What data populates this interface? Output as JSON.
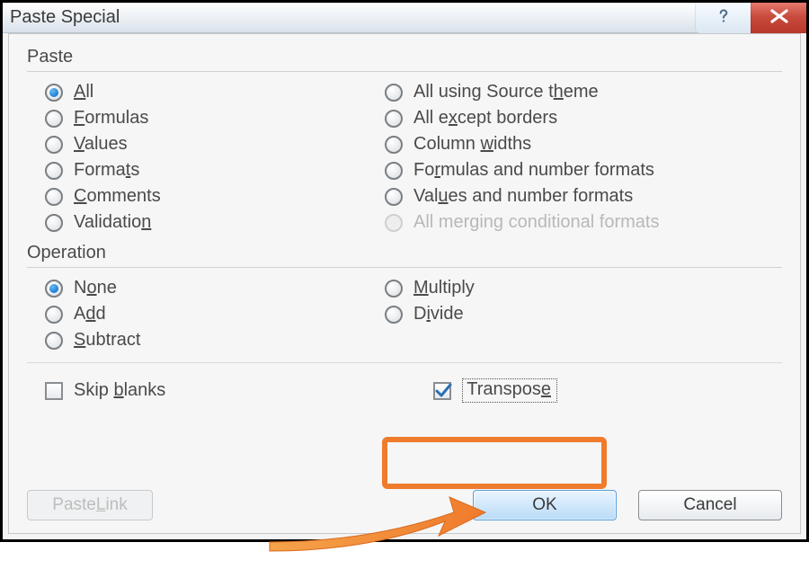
{
  "title": "Paste Special",
  "groups": {
    "paste": {
      "label": "Paste",
      "left": [
        {
          "id": "all",
          "pre": "",
          "u": "A",
          "post": "ll",
          "selected": true,
          "disabled": false
        },
        {
          "id": "formulas",
          "pre": "",
          "u": "F",
          "post": "ormulas",
          "selected": false,
          "disabled": false
        },
        {
          "id": "values",
          "pre": "",
          "u": "V",
          "post": "alues",
          "selected": false,
          "disabled": false
        },
        {
          "id": "formats",
          "pre": "Forma",
          "u": "t",
          "post": "s",
          "selected": false,
          "disabled": false
        },
        {
          "id": "comments",
          "pre": "",
          "u": "C",
          "post": "omments",
          "selected": false,
          "disabled": false
        },
        {
          "id": "validation",
          "pre": "Validatio",
          "u": "n",
          "post": "",
          "selected": false,
          "disabled": false
        }
      ],
      "right": [
        {
          "id": "all-src-theme",
          "pre": "All using Source t",
          "u": "h",
          "post": "eme",
          "selected": false,
          "disabled": false
        },
        {
          "id": "all-except-borders",
          "pre": "All e",
          "u": "x",
          "post": "cept borders",
          "selected": false,
          "disabled": false
        },
        {
          "id": "column-widths",
          "pre": "Column ",
          "u": "w",
          "post": "idths",
          "selected": false,
          "disabled": false
        },
        {
          "id": "formulas-num-formats",
          "pre": "Fo",
          "u": "r",
          "post": "mulas and number formats",
          "selected": false,
          "disabled": false
        },
        {
          "id": "values-num-formats",
          "pre": "Val",
          "u": "u",
          "post": "es and number formats",
          "selected": false,
          "disabled": false
        },
        {
          "id": "all-merging-cond",
          "pre": "All mer",
          "u": "g",
          "post": "ing conditional formats",
          "selected": false,
          "disabled": true
        }
      ]
    },
    "operation": {
      "label": "Operation",
      "left": [
        {
          "id": "none",
          "pre": "N",
          "u": "o",
          "post": "ne",
          "selected": true,
          "disabled": false
        },
        {
          "id": "add",
          "pre": "A",
          "u": "d",
          "post": "d",
          "selected": false,
          "disabled": false
        },
        {
          "id": "subtract",
          "pre": "",
          "u": "S",
          "post": "ubtract",
          "selected": false,
          "disabled": false
        }
      ],
      "right": [
        {
          "id": "multiply",
          "pre": "",
          "u": "M",
          "post": "ultiply",
          "selected": false,
          "disabled": false
        },
        {
          "id": "divide",
          "pre": "D",
          "u": "i",
          "post": "vide",
          "selected": false,
          "disabled": false
        }
      ]
    }
  },
  "checks": {
    "skip_blanks": {
      "pre": "Skip ",
      "u": "b",
      "post": "lanks",
      "checked": false
    },
    "transpose": {
      "pre": "Transpos",
      "u": "e",
      "post": "",
      "checked": true,
      "focused": true
    }
  },
  "buttons": {
    "paste_link": {
      "pre": "Paste ",
      "u": "L",
      "post": "ink",
      "disabled": true
    },
    "ok": "OK",
    "cancel": "Cancel"
  },
  "annotations": {
    "highlight": "transpose",
    "arrow_target": "ok"
  }
}
